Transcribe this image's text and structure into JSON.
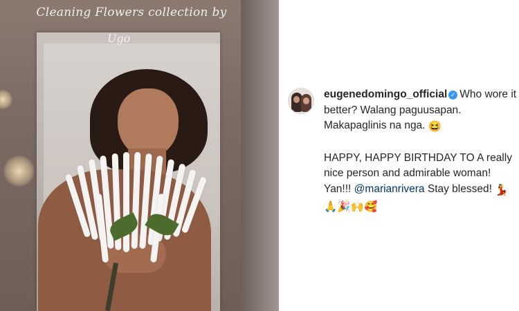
{
  "photo": {
    "overlay_caption": "Cleaning Flowers collection by",
    "overlay_signature": "Ugo"
  },
  "post": {
    "username": "eugenedomingo_official",
    "caption_part1": "Who wore it better? Walang paguusapan. Makapaglinis na nga.",
    "caption_part2_a": "HAPPY, HAPPY BIRTHDAY TO A really nice person and admirable woman! Yan!!!",
    "mention": "@marianrivera",
    "caption_part2_b": "Stay blessed!",
    "emoji_laugh": "😆",
    "emoji_row": [
      "💃",
      "🙏",
      "🎉",
      "🙌",
      "🥰"
    ]
  },
  "colors": {
    "verified_badge": "#3897f0",
    "mention": "#003569",
    "text": "#262626"
  }
}
